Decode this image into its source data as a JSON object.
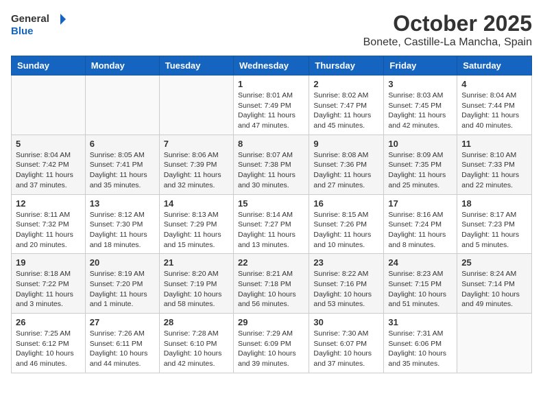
{
  "header": {
    "logo_general": "General",
    "logo_blue": "Blue",
    "month": "October 2025",
    "location": "Bonete, Castille-La Mancha, Spain"
  },
  "weekdays": [
    "Sunday",
    "Monday",
    "Tuesday",
    "Wednesday",
    "Thursday",
    "Friday",
    "Saturday"
  ],
  "weeks": [
    [
      {
        "day": "",
        "info": ""
      },
      {
        "day": "",
        "info": ""
      },
      {
        "day": "",
        "info": ""
      },
      {
        "day": "1",
        "info": "Sunrise: 8:01 AM\nSunset: 7:49 PM\nDaylight: 11 hours and 47 minutes."
      },
      {
        "day": "2",
        "info": "Sunrise: 8:02 AM\nSunset: 7:47 PM\nDaylight: 11 hours and 45 minutes."
      },
      {
        "day": "3",
        "info": "Sunrise: 8:03 AM\nSunset: 7:45 PM\nDaylight: 11 hours and 42 minutes."
      },
      {
        "day": "4",
        "info": "Sunrise: 8:04 AM\nSunset: 7:44 PM\nDaylight: 11 hours and 40 minutes."
      }
    ],
    [
      {
        "day": "5",
        "info": "Sunrise: 8:04 AM\nSunset: 7:42 PM\nDaylight: 11 hours and 37 minutes."
      },
      {
        "day": "6",
        "info": "Sunrise: 8:05 AM\nSunset: 7:41 PM\nDaylight: 11 hours and 35 minutes."
      },
      {
        "day": "7",
        "info": "Sunrise: 8:06 AM\nSunset: 7:39 PM\nDaylight: 11 hours and 32 minutes."
      },
      {
        "day": "8",
        "info": "Sunrise: 8:07 AM\nSunset: 7:38 PM\nDaylight: 11 hours and 30 minutes."
      },
      {
        "day": "9",
        "info": "Sunrise: 8:08 AM\nSunset: 7:36 PM\nDaylight: 11 hours and 27 minutes."
      },
      {
        "day": "10",
        "info": "Sunrise: 8:09 AM\nSunset: 7:35 PM\nDaylight: 11 hours and 25 minutes."
      },
      {
        "day": "11",
        "info": "Sunrise: 8:10 AM\nSunset: 7:33 PM\nDaylight: 11 hours and 22 minutes."
      }
    ],
    [
      {
        "day": "12",
        "info": "Sunrise: 8:11 AM\nSunset: 7:32 PM\nDaylight: 11 hours and 20 minutes."
      },
      {
        "day": "13",
        "info": "Sunrise: 8:12 AM\nSunset: 7:30 PM\nDaylight: 11 hours and 18 minutes."
      },
      {
        "day": "14",
        "info": "Sunrise: 8:13 AM\nSunset: 7:29 PM\nDaylight: 11 hours and 15 minutes."
      },
      {
        "day": "15",
        "info": "Sunrise: 8:14 AM\nSunset: 7:27 PM\nDaylight: 11 hours and 13 minutes."
      },
      {
        "day": "16",
        "info": "Sunrise: 8:15 AM\nSunset: 7:26 PM\nDaylight: 11 hours and 10 minutes."
      },
      {
        "day": "17",
        "info": "Sunrise: 8:16 AM\nSunset: 7:24 PM\nDaylight: 11 hours and 8 minutes."
      },
      {
        "day": "18",
        "info": "Sunrise: 8:17 AM\nSunset: 7:23 PM\nDaylight: 11 hours and 5 minutes."
      }
    ],
    [
      {
        "day": "19",
        "info": "Sunrise: 8:18 AM\nSunset: 7:22 PM\nDaylight: 11 hours and 3 minutes."
      },
      {
        "day": "20",
        "info": "Sunrise: 8:19 AM\nSunset: 7:20 PM\nDaylight: 11 hours and 1 minute."
      },
      {
        "day": "21",
        "info": "Sunrise: 8:20 AM\nSunset: 7:19 PM\nDaylight: 10 hours and 58 minutes."
      },
      {
        "day": "22",
        "info": "Sunrise: 8:21 AM\nSunset: 7:18 PM\nDaylight: 10 hours and 56 minutes."
      },
      {
        "day": "23",
        "info": "Sunrise: 8:22 AM\nSunset: 7:16 PM\nDaylight: 10 hours and 53 minutes."
      },
      {
        "day": "24",
        "info": "Sunrise: 8:23 AM\nSunset: 7:15 PM\nDaylight: 10 hours and 51 minutes."
      },
      {
        "day": "25",
        "info": "Sunrise: 8:24 AM\nSunset: 7:14 PM\nDaylight: 10 hours and 49 minutes."
      }
    ],
    [
      {
        "day": "26",
        "info": "Sunrise: 7:25 AM\nSunset: 6:12 PM\nDaylight: 10 hours and 46 minutes."
      },
      {
        "day": "27",
        "info": "Sunrise: 7:26 AM\nSunset: 6:11 PM\nDaylight: 10 hours and 44 minutes."
      },
      {
        "day": "28",
        "info": "Sunrise: 7:28 AM\nSunset: 6:10 PM\nDaylight: 10 hours and 42 minutes."
      },
      {
        "day": "29",
        "info": "Sunrise: 7:29 AM\nSunset: 6:09 PM\nDaylight: 10 hours and 39 minutes."
      },
      {
        "day": "30",
        "info": "Sunrise: 7:30 AM\nSunset: 6:07 PM\nDaylight: 10 hours and 37 minutes."
      },
      {
        "day": "31",
        "info": "Sunrise: 7:31 AM\nSunset: 6:06 PM\nDaylight: 10 hours and 35 minutes."
      },
      {
        "day": "",
        "info": ""
      }
    ]
  ]
}
